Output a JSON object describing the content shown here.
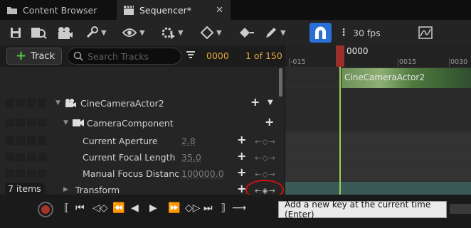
{
  "tabs": [
    {
      "label": "Content Browser",
      "icon": "folder-icon"
    },
    {
      "label": "Sequencer*",
      "icon": "clapperboard-icon"
    }
  ],
  "toolbar": {
    "fps": "30 fps",
    "icons": [
      "save-icon",
      "find-asset-icon",
      "camera-icon",
      "tools-icon",
      "view-options-icon",
      "playback-options-icon",
      "key-options-icon",
      "auto-key-icon",
      "edit-options-icon",
      "snap-magnet-icon",
      "more-icon",
      "curve-editor-icon"
    ]
  },
  "track_header": {
    "add_track_label": "Track",
    "search_placeholder": "Search Tracks",
    "current_frame": "0000",
    "frame_range": "1 of 150"
  },
  "outliner": {
    "rows": [
      {
        "label": "CineCameraActor2",
        "type": "actor"
      },
      {
        "label": "CameraComponent",
        "type": "component"
      },
      {
        "label": "Current Aperture",
        "value": "2.8"
      },
      {
        "label": "Current Focal Length",
        "value": "35.0"
      },
      {
        "label": "Manual Focus Distance (",
        "value": "100000.0"
      },
      {
        "label": "Transform",
        "type": "track"
      }
    ],
    "items_count": "7 items"
  },
  "timeline": {
    "playhead_label": "0000",
    "ticks": [
      "-015",
      "0015",
      "0030"
    ],
    "clip_label": "CineCameraActor2"
  },
  "tooltip": "Add a new key at the current time (Enter)",
  "colors": {
    "accent_blue": "#2a6fd6",
    "frame_orange": "#e7a53b",
    "playhead_red": "#9b2f2a",
    "playhead_green": "#9bcf5a",
    "annotation_red": "#d01010"
  }
}
